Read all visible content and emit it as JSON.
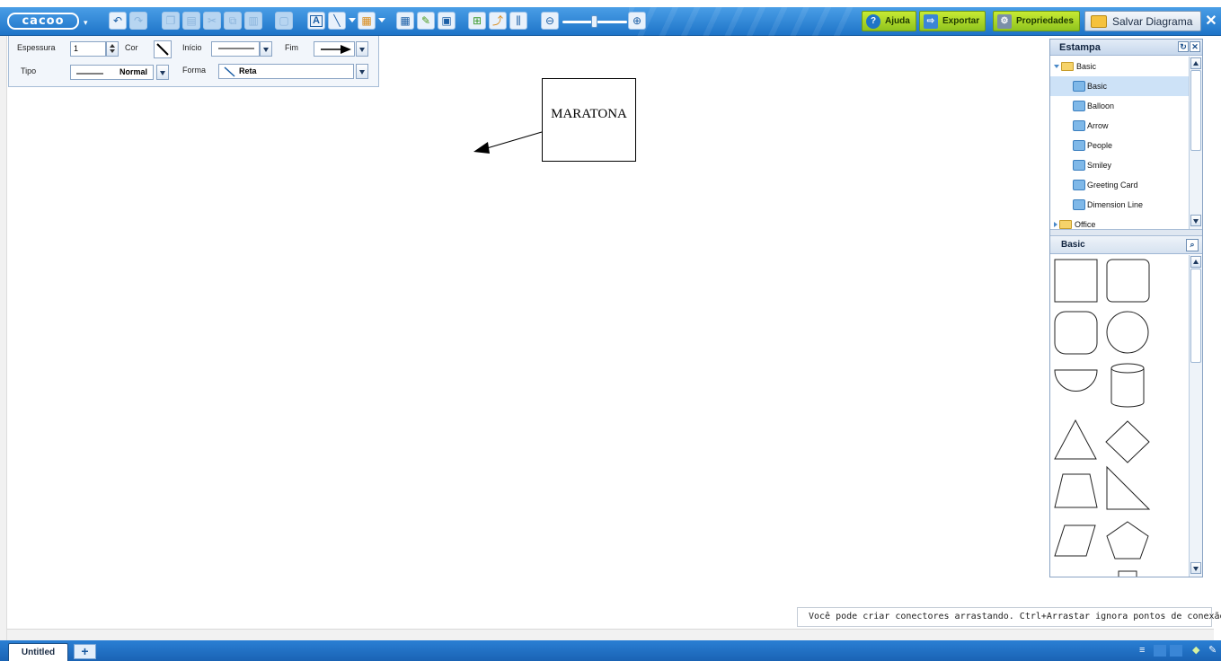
{
  "app": {
    "logo_text": "cacoo"
  },
  "toolbar": {
    "help_label": "Ajuda",
    "export_label": "Exportar",
    "properties_label": "Propriedades",
    "save_label": "Salvar Diagrama",
    "icons": [
      "undo-icon",
      "redo-icon",
      "copy-icon",
      "paste-icon",
      "cut-icon",
      "duplicate-icon",
      "delete-icon",
      "group-icon",
      "text-tool-icon",
      "line-tool-icon",
      "shape-tool-icon",
      "table-tool-icon",
      "pencil-icon",
      "image-icon",
      "grid-icon",
      "connect-icon",
      "align-icon",
      "zoom-out-icon",
      "zoom-in-icon"
    ],
    "colors": {
      "toolbar_blue": "#1e74c8",
      "green_button": "#8fc31f"
    }
  },
  "line_props": {
    "thickness_label": "Espessura",
    "thickness_value": "1",
    "color_label": "Cor",
    "start_label": "Início",
    "end_label": "Fim",
    "type_label": "Tipo",
    "type_value": "Normal",
    "shape_label": "Forma",
    "shape_value": "Reta"
  },
  "canvas": {
    "shape_text": "MARATONA"
  },
  "stencil": {
    "title": "Estampa",
    "tree": [
      {
        "label": "Basic",
        "kind": "folder-open"
      },
      {
        "label": "Basic",
        "kind": "leaf",
        "selected": true
      },
      {
        "label": "Balloon",
        "kind": "leaf"
      },
      {
        "label": "Arrow",
        "kind": "leaf"
      },
      {
        "label": "People",
        "kind": "leaf"
      },
      {
        "label": "Smiley",
        "kind": "leaf"
      },
      {
        "label": "Greeting Card",
        "kind": "leaf"
      },
      {
        "label": "Dimension Line",
        "kind": "leaf"
      },
      {
        "label": "Office",
        "kind": "folder-closed"
      }
    ],
    "category_title": "Basic",
    "shapes": [
      "rectangle",
      "rounded-rectangle",
      "rounded-square",
      "circle",
      "half-circle",
      "cylinder",
      "triangle",
      "diamond",
      "trapezoid",
      "right-triangle",
      "parallelogram",
      "pentagon"
    ]
  },
  "hint": {
    "text": "Você pode criar conectores arrastando. Ctrl+Arrastar ignora pontos de conexão."
  },
  "tabs": {
    "active_label": "Untitled",
    "add_label": "+"
  }
}
